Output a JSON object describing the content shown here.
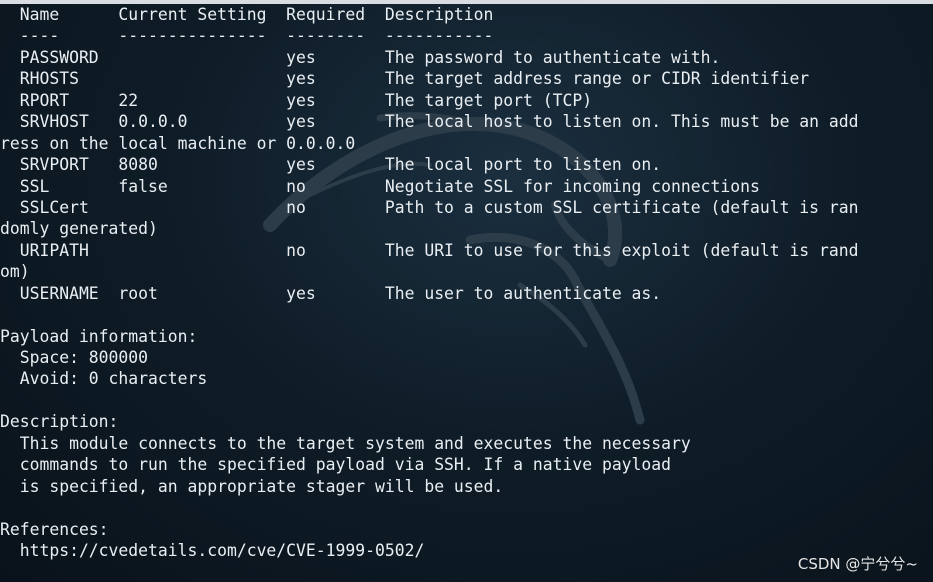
{
  "terminal": {
    "lines": [
      "  Name      Current Setting  Required  Description",
      "  ----      ---------------  --------  -----------",
      "  PASSWORD                   yes       The password to authenticate with.",
      "  RHOSTS                     yes       The target address range or CIDR identifier",
      "  RPORT     22               yes       The target port (TCP)",
      "  SRVHOST   0.0.0.0          yes       The local host to listen on. This must be an add",
      "ress on the local machine or 0.0.0.0",
      "  SRVPORT   8080             yes       The local port to listen on.",
      "  SSL       false            no        Negotiate SSL for incoming connections",
      "  SSLCert                    no        Path to a custom SSL certificate (default is ran",
      "domly generated)",
      "  URIPATH                    no        The URI to use for this exploit (default is rand",
      "om)",
      "  USERNAME  root             yes       The user to authenticate as.",
      "",
      "Payload information:",
      "  Space: 800000",
      "  Avoid: 0 characters",
      "",
      "Description:",
      "  This module connects to the target system and executes the necessary",
      "  commands to run the specified payload via SSH. If a native payload",
      "  is specified, an appropriate stager will be used.",
      "",
      "References:",
      "  https://cvedetails.com/cve/CVE-1999-0502/"
    ]
  },
  "watermark": "CSDN @宁兮兮~",
  "colors": {
    "text": "#e9eef2",
    "background": "#0f1d28",
    "dragon": "#2a3a47"
  },
  "icons": [
    "kali-dragon-icon"
  ]
}
